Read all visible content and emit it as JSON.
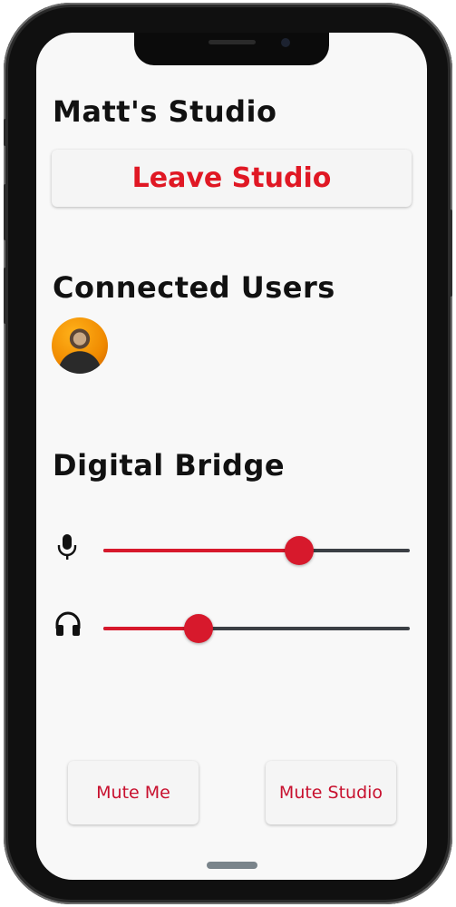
{
  "studio": {
    "title": "Matt's Studio",
    "leave_label": "Leave Studio"
  },
  "users": {
    "heading": "Connected Users",
    "avatars": [
      {
        "icon": "user-avatar"
      }
    ]
  },
  "bridge": {
    "heading": "Digital Bridge",
    "mic": {
      "icon": "microphone-icon",
      "level": 0.64
    },
    "headphones": {
      "icon": "headphones-icon",
      "level": 0.31
    }
  },
  "actions": {
    "mute_me_label": "Mute Me",
    "mute_studio_label": "Mute Studio"
  },
  "colors": {
    "accent": "#d7192c",
    "text": "#111111",
    "button_bg": "#f5f5f5",
    "background": "#f8f8f8"
  }
}
